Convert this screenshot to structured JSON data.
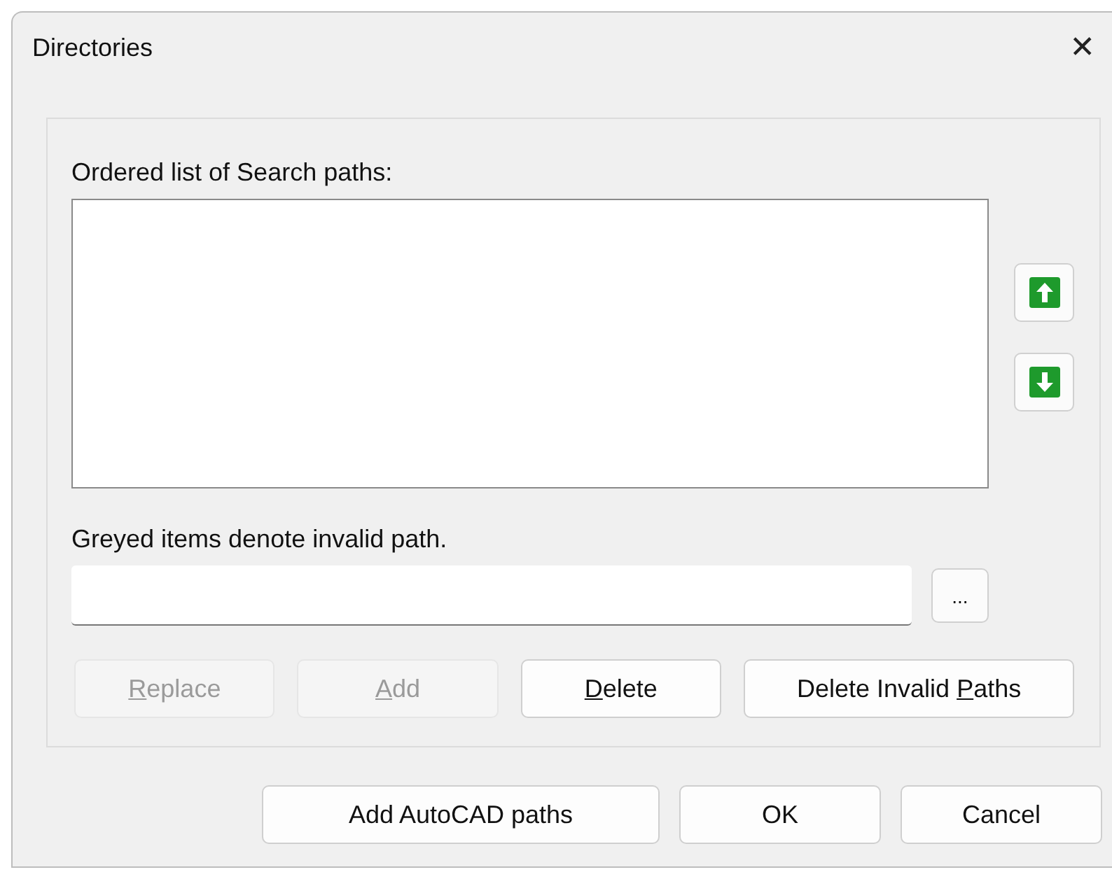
{
  "window": {
    "title": "Directories",
    "close": "✕"
  },
  "list": {
    "label": "Ordered list of Search paths:"
  },
  "move_buttons": [
    {
      "kind": "up"
    },
    {
      "kind": "down"
    }
  ],
  "note": "Greyed items denote invalid path.",
  "path_field": {
    "browse": "..."
  },
  "actions": [
    {
      "key": "R",
      "post": "eplace",
      "disabled": true
    },
    {
      "key": "A",
      "post": "dd",
      "disabled": true
    },
    {
      "key": "D",
      "post": "elete",
      "disabled": false
    },
    {
      "pre": "Delete Invalid ",
      "key": "P",
      "post": "aths",
      "disabled": false
    }
  ],
  "buttons": [
    "Add AutoCAD paths",
    "OK",
    "Cancel"
  ]
}
